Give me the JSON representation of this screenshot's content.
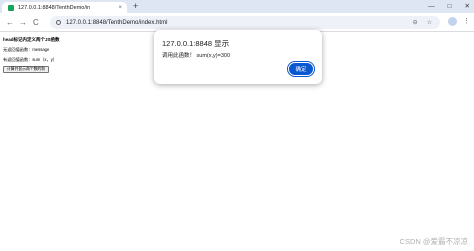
{
  "browser": {
    "tab": {
      "title": "127.0.0.1:8848/TenthDemo/in",
      "close": "×"
    },
    "new_tab": "+",
    "window_controls": [
      "—",
      "□",
      "✕"
    ],
    "url": "127.0.0.1:8848/TenthDemo/index.html",
    "nav": {
      "back": "←",
      "forward": "→",
      "reload": "C"
    },
    "omni_icons": [
      "⊖",
      "☆"
    ],
    "menu": "⋮"
  },
  "page": {
    "heading": "head标记内定义两个JS函数",
    "lines": [
      "无返回值函数：message",
      "有返回值函数：sum（x，y）"
    ],
    "button_label": "计算并显示两个数的和"
  },
  "dialog": {
    "title": "127.0.0.1:8848 显示",
    "message": "调用此函数！ sum(x,y)=300",
    "ok_label": "确定"
  },
  "watermark": "CSDN @爱霸不凉凉",
  "colors": {
    "tabstrip": "#dfe6f3",
    "accent": "#0b57d0",
    "favicon": "#19a35a"
  }
}
